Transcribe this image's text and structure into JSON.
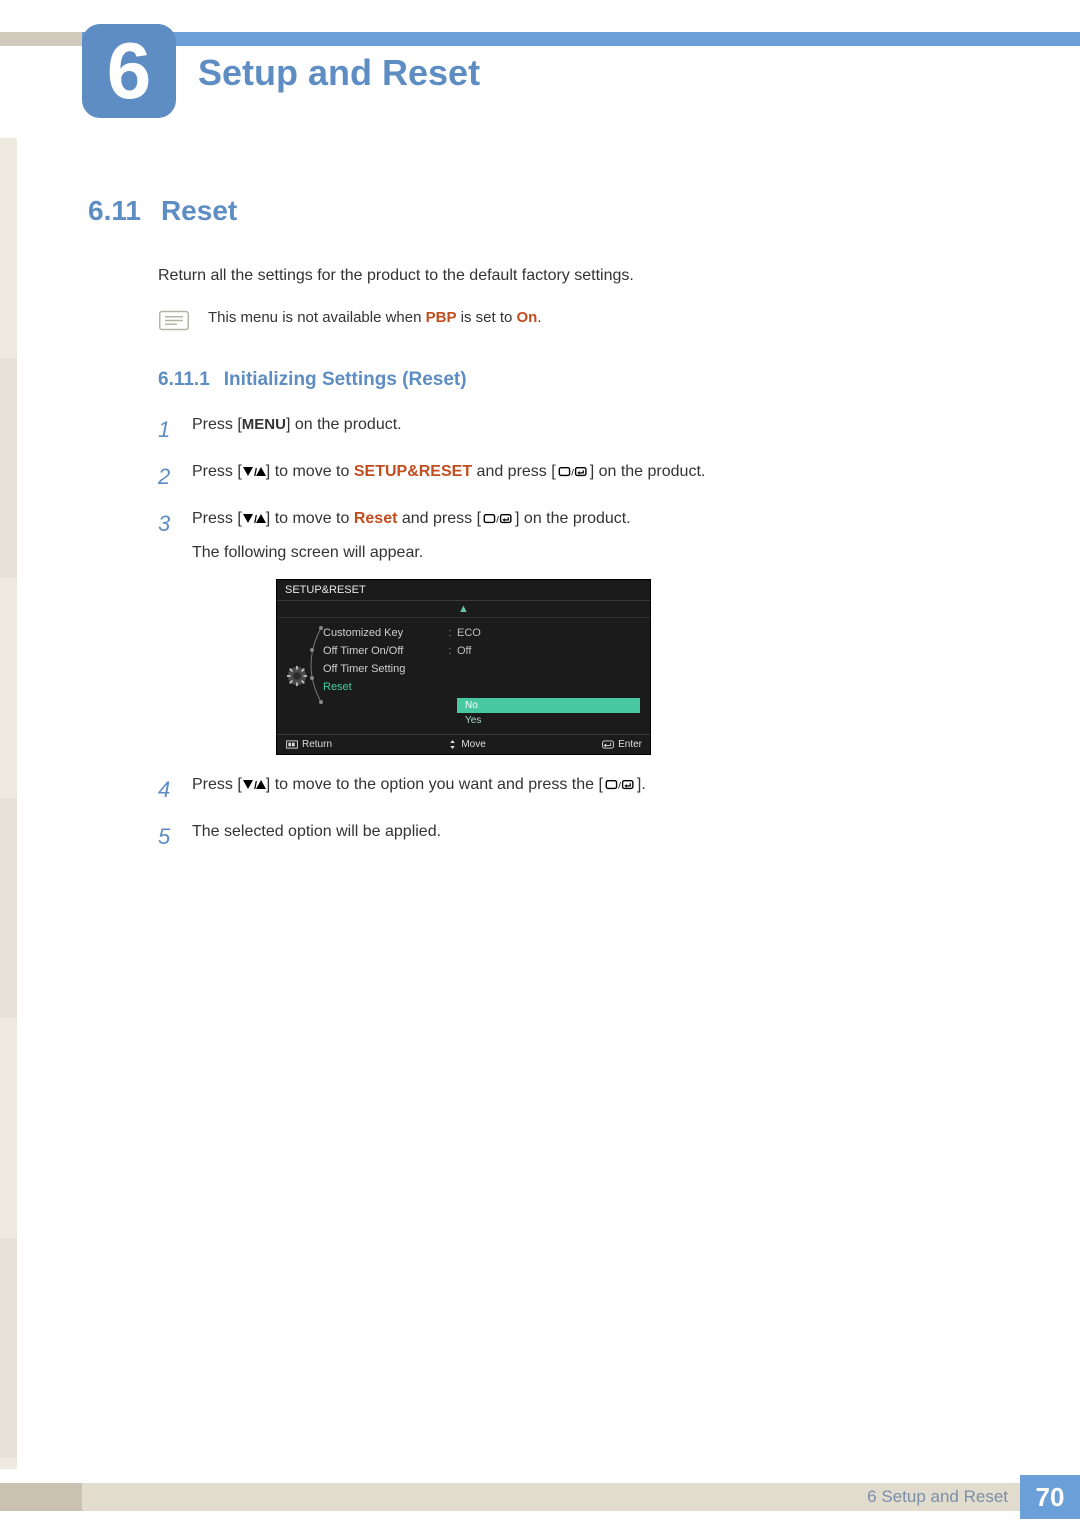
{
  "chapter": {
    "number": "6",
    "title": "Setup and Reset"
  },
  "section": {
    "number": "6.11",
    "title": "Reset"
  },
  "intro": "Return all the settings for the product to the default factory settings.",
  "note": {
    "prefix": "This menu is not available when ",
    "pbp": "PBP",
    "middle": " is set to ",
    "on": "On",
    "suffix": "."
  },
  "subsection": {
    "number": "6.11.1",
    "title": "Initializing Settings (Reset)"
  },
  "steps": {
    "s1": {
      "n": "1",
      "a": "Press [",
      "menu": "MENU",
      "b": "] on the product."
    },
    "s2": {
      "n": "2",
      "a": "Press [",
      "b": "] to move to ",
      "target": "SETUP&RESET",
      "c": " and press [",
      "d": "] on the product."
    },
    "s3": {
      "n": "3",
      "a": "Press [",
      "b": "] to move to ",
      "target": "Reset",
      "c": " and press [",
      "d": "] on the product.",
      "sub": "The following screen will appear."
    },
    "s4": {
      "n": "4",
      "a": "Press [",
      "b": "] to move to the option you want and press the [",
      "c": "]."
    },
    "s5": {
      "n": "5",
      "a": "The selected option will be applied."
    }
  },
  "osd": {
    "title": "SETUP&RESET",
    "rows": [
      {
        "label": "Customized Key",
        "value": "ECO"
      },
      {
        "label": "Off Timer On/Off",
        "value": "Off"
      },
      {
        "label": "Off Timer Setting",
        "value": ""
      },
      {
        "label": "Reset",
        "value": "",
        "highlight": true
      }
    ],
    "options": {
      "no": "No",
      "yes": "Yes"
    },
    "footer": {
      "return": "Return",
      "move": "Move",
      "enter": "Enter"
    }
  },
  "footer": {
    "label": "6 Setup and Reset",
    "page": "70"
  }
}
